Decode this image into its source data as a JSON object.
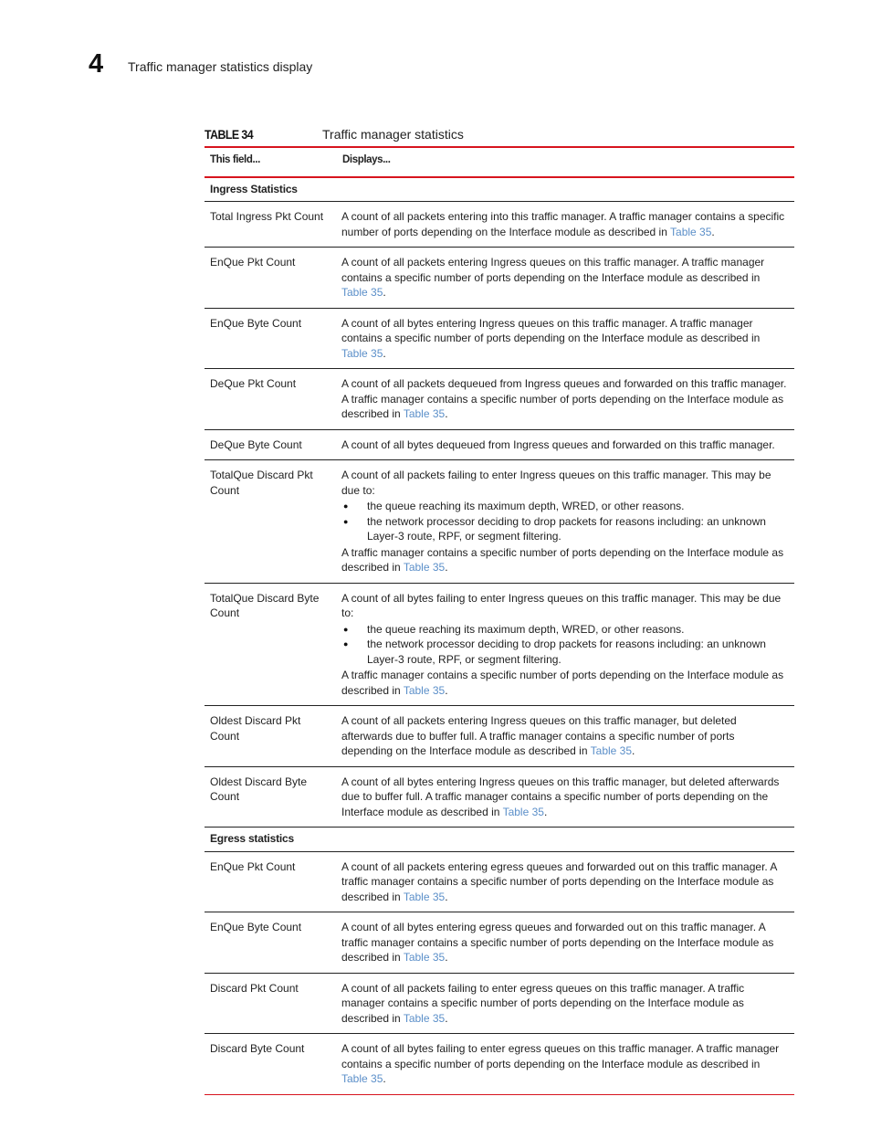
{
  "header": {
    "chapter_number": "4",
    "chapter_title": "Traffic manager statistics display"
  },
  "table": {
    "label": "TABLE 34",
    "title": "Traffic manager statistics",
    "columns": [
      "This field...",
      "Displays..."
    ],
    "link_color": "#5b8fc9",
    "rule_color": "#d7141e",
    "xref": "Table 35",
    "sections": [
      {
        "heading": "Ingress Statistics",
        "rows": [
          {
            "field": "Total Ingress Pkt Count",
            "desc": "A count of all packets entering into this traffic manager. A traffic manager contains a specific number of ports depending on the Interface module as described in ",
            "tail": "."
          },
          {
            "field": "EnQue Pkt Count",
            "desc": "A count of all packets entering Ingress queues on this traffic manager. A traffic manager contains a specific number of ports depending on the Interface module as described in ",
            "tail": "."
          },
          {
            "field": "EnQue Byte Count",
            "desc": "A count of all bytes entering Ingress queues on this traffic manager. A traffic manager contains a specific number of ports depending on the Interface module as described in ",
            "tail": "."
          },
          {
            "field": "DeQue Pkt Count",
            "desc": "A count of all packets dequeued from Ingress queues and forwarded on this traffic manager. A traffic manager contains a specific number of ports depending on the Interface module as described in ",
            "tail": "."
          },
          {
            "field": "DeQue Byte Count",
            "desc": "A count of all bytes dequeued from Ingress queues and forwarded on this traffic manager."
          },
          {
            "field": "TotalQue Discard Pkt Count",
            "desc": "A count of all packets failing to enter Ingress queues on this traffic manager. This may be due to:",
            "bullets": [
              "the queue reaching its maximum depth, WRED, or other reasons.",
              "the network processor deciding to drop packets for reasons including: an unknown Layer-3 route, RPF, or segment filtering."
            ],
            "after": "A traffic manager contains a specific number of ports depending on the Interface module as described in ",
            "tail": "."
          },
          {
            "field": "TotalQue Discard Byte Count",
            "desc": "A count of all bytes failing to enter Ingress queues on this traffic manager. This may be due to:",
            "bullets": [
              "the queue reaching its maximum depth, WRED, or other reasons.",
              "the network processor deciding to drop packets for reasons including: an unknown Layer-3 route, RPF, or segment filtering."
            ],
            "after": "A traffic manager contains a specific number of ports depending on the Interface module as described in ",
            "tail": "."
          },
          {
            "field": "Oldest Discard Pkt Count",
            "desc": "A count of all packets entering Ingress queues on this traffic manager, but deleted afterwards due to buffer full. A traffic manager contains a specific number of ports depending on the Interface module as described in ",
            "tail": "."
          },
          {
            "field": "Oldest Discard Byte Count",
            "desc": "A count of all bytes entering Ingress queues on this traffic manager, but deleted afterwards due to buffer full. A traffic manager contains a specific number of ports depending on the Interface module as described in ",
            "tail": "."
          }
        ]
      },
      {
        "heading": "Egress statistics",
        "rows": [
          {
            "field": "EnQue Pkt Count",
            "desc": "A count of all packets entering egress queues and forwarded out on this traffic manager. A traffic manager contains a specific number of ports depending on the Interface module as described in ",
            "tail": "."
          },
          {
            "field": "EnQue Byte Count",
            "desc": "A count of all bytes entering egress queues and forwarded out on this traffic manager. A traffic manager contains a specific number of ports depending on the Interface module as described in ",
            "tail": "."
          },
          {
            "field": "Discard Pkt Count",
            "desc": "A count of all packets failing to enter egress queues on this traffic manager. A traffic manager contains a specific number of ports depending on the Interface module as described in ",
            "tail": "."
          },
          {
            "field": "Discard Byte Count",
            "desc": "A count of all bytes failing to enter egress queues on this traffic manager. A traffic manager contains a specific number of ports depending on the Interface module as described in ",
            "tail": "."
          }
        ]
      }
    ]
  }
}
